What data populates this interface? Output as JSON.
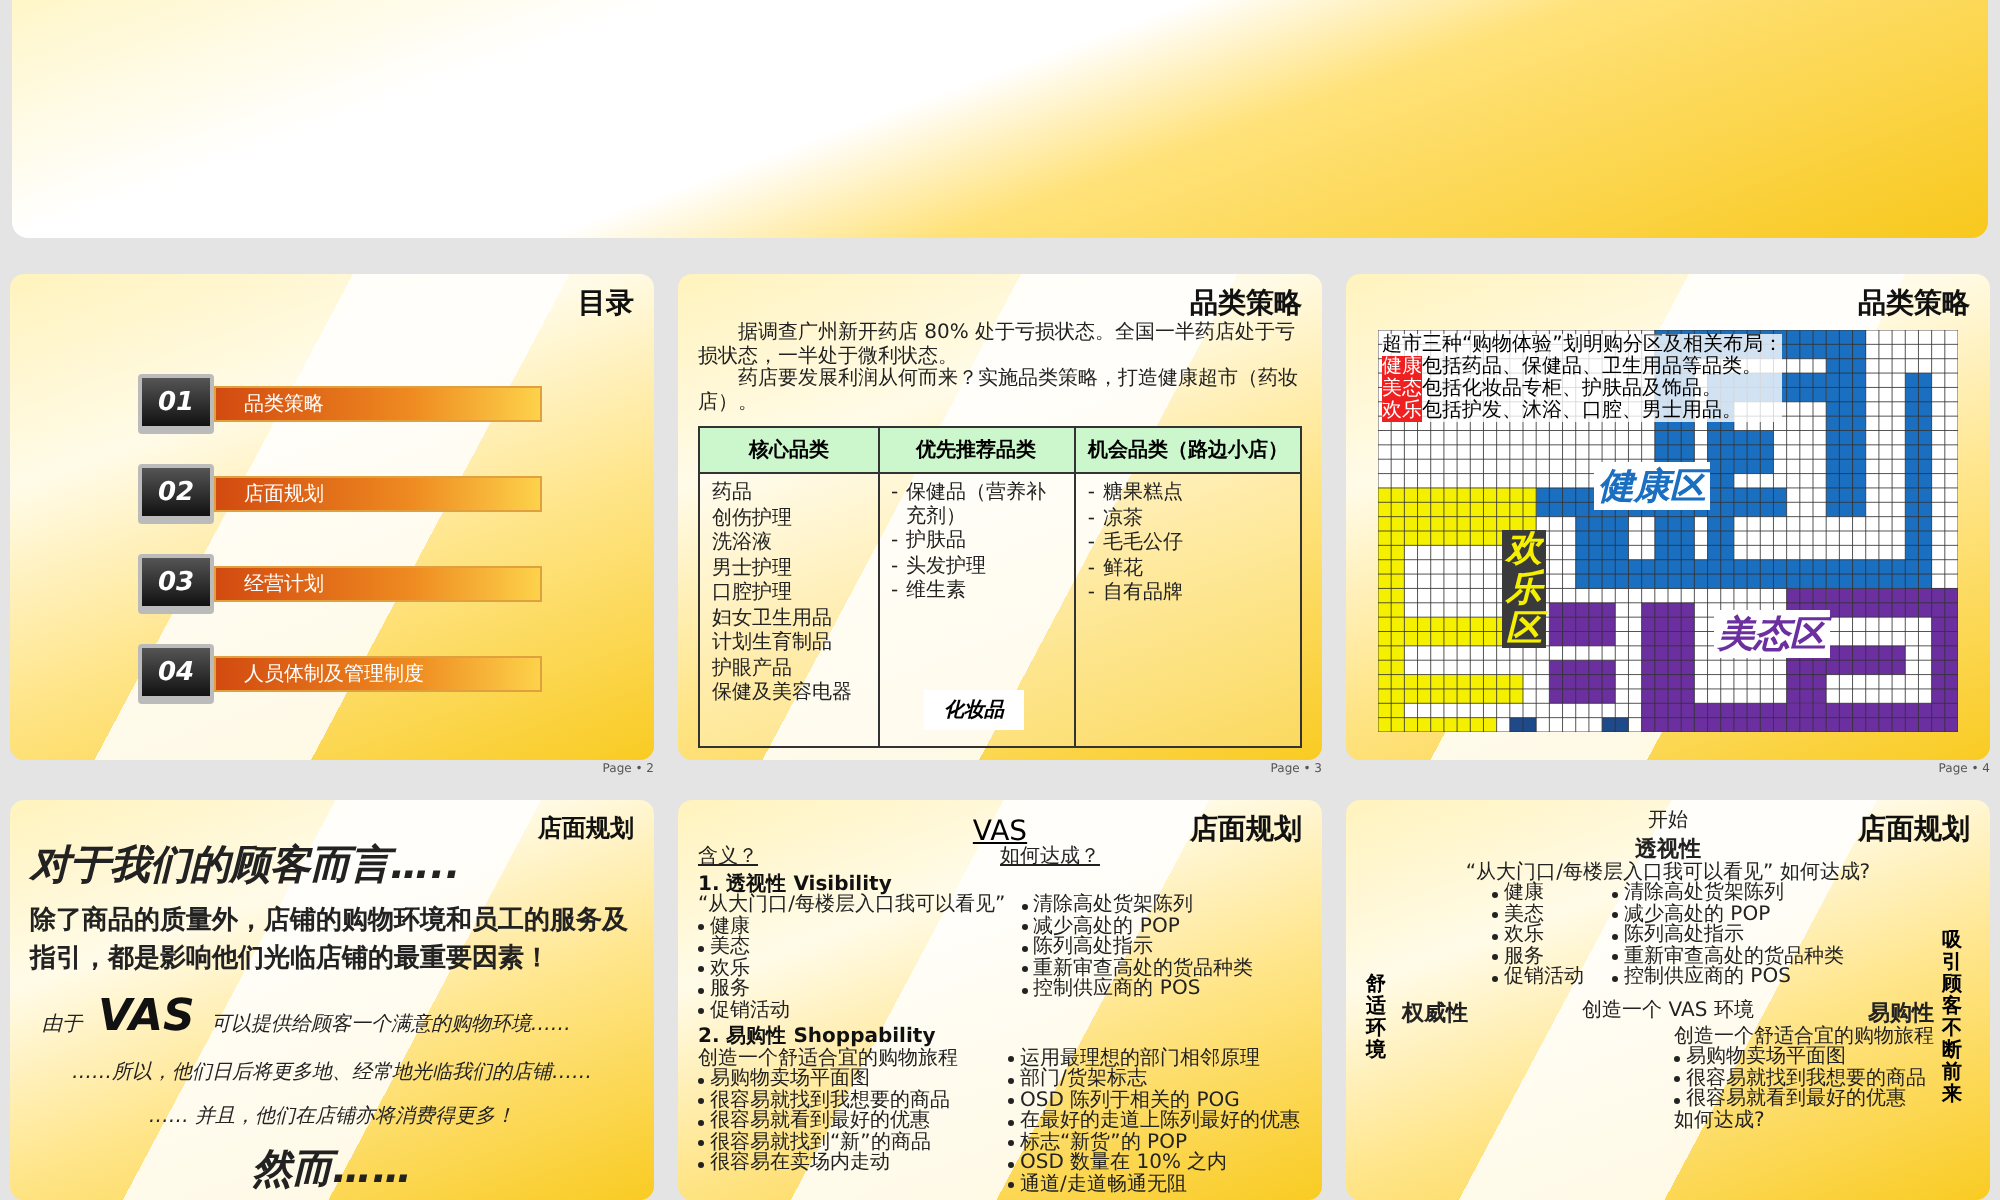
{
  "slides": [
    {
      "kind": "contents",
      "title": "目录",
      "page": "Page • 2",
      "items": [
        {
          "number": "01",
          "label": "品类策略"
        },
        {
          "number": "02",
          "label": "店面规划"
        },
        {
          "number": "03",
          "label": "经营计划"
        },
        {
          "number": "04",
          "label": "人员体制及管理制度"
        }
      ]
    },
    {
      "kind": "table",
      "title": "品类策略",
      "page": "Page • 3",
      "paragraphs": [
        "据调查广州新开药店 80% 处于亏损状态。全国一半药店处于亏损状态，一半处于微利状态。",
        "药店要发展利润从何而来？实施品类策略，打造健康超市（药妆店）。"
      ],
      "columns": [
        {
          "header": "核心品类",
          "items": [
            "药品",
            "创伤护理",
            "洗浴液",
            "男士护理",
            "口腔护理",
            "妇女卫生用品",
            "计划生育制品",
            "护眼产品",
            "保健及美容电器"
          ]
        },
        {
          "header": "优先推荐品类",
          "marker": "-",
          "items": [
            "保健品（营养补充剂）",
            "护肤品",
            "头发护理",
            "维生素"
          ]
        },
        {
          "header": "机会品类（路边小店）",
          "marker": "-",
          "items": [
            "糖果糕点",
            "凉茶",
            "毛毛公仔",
            "鲜花",
            "自有品牌"
          ]
        }
      ],
      "tag": "化妆品"
    },
    {
      "kind": "zones",
      "title": "品类策略",
      "page": "Page • 4",
      "intro": "超市三种“购物体验”划明购分区及相关布局：",
      "lines": [
        {
          "tag": "健康",
          "text": "包括药品、保健品、卫生用品等品类。"
        },
        {
          "tag": "美态",
          "text": "包括化妆品专柜、护肤品及饰品。"
        },
        {
          "tag": "欢乐",
          "text": "包括护发、沐浴、口腔、男士用品。"
        }
      ],
      "zones": [
        {
          "label": "健康区",
          "color": "#1a6fc0"
        },
        {
          "label": "欢乐区",
          "color": "#f5ef00"
        },
        {
          "label": "美态区",
          "color": "#6b2fa0"
        }
      ]
    },
    {
      "kind": "text",
      "title": "店面规划",
      "heading": "对于我们的顾客而言…..",
      "body": "除了商品的质量外，店铺的购物环境和员工的服务及指引，都是影响他们光临店铺的最重要因素！",
      "lead": "由于",
      "brand": "VAS",
      "lines": [
        "可以提供给顾客一个满意的购物环境……",
        "……所以，他们日后将更多地、经常地光临我们的店铺……",
        "…… 并且，他们在店铺亦将消费得更多！"
      ],
      "closing": "然而……"
    },
    {
      "kind": "vas",
      "title": "店面规划",
      "heading": "VAS",
      "headers": [
        "含义？",
        "如何达成？"
      ],
      "sections": [
        {
          "number": "1.",
          "name": "透视性",
          "english": "Visibility",
          "meaning": [
            "“从大门口/每楼层入口我可以看见”",
            "健康",
            "美态",
            "欢乐",
            "服务",
            "促销活动"
          ],
          "how": [
            "清除高处货架陈列",
            "减少高处的 POP",
            "陈列高处指示",
            "重新审查高处的货品种类",
            "控制供应商的 POS"
          ]
        },
        {
          "number": "2.",
          "name": "易购性",
          "english": "Shoppability",
          "meaning": [
            "创造一个舒适合宜的购物旅程",
            "易购物卖场平面图",
            "很容易就找到我想要的商品",
            "很容易就看到最好的优惠",
            "很容易就找到“新”的商品",
            "很容易在卖场内走动"
          ],
          "how": [
            "运用最理想的部门相邻原理",
            "部门/货架标志",
            "OSD 陈列于相关的 POG",
            "在最好的走道上陈列最好的优惠",
            "标志“新货”的 POP",
            "OSD 数量在 10% 之内",
            "通道/走道畅通无阻"
          ]
        }
      ]
    },
    {
      "kind": "map",
      "title": "店面规划",
      "start": "开始",
      "top": {
        "name": "透视性",
        "question": "“从大门口/每楼层入口我可以看见” 如何达成?",
        "left": [
          "健康",
          "美态",
          "欢乐",
          "服务",
          "促销活动"
        ],
        "right": [
          "清除高处货架陈列",
          "减少高处的 POP",
          "陈列高处指示",
          "重新审查高处的货品种类",
          "控制供应商的 POS"
        ]
      },
      "left_name": "权威性",
      "center": "创造一个 VAS 环境",
      "right_name": "易购性",
      "right_intro": "创造一个舒适合宜的购物旅程",
      "how": "如何达成?",
      "right_items": [
        "易购物卖场平面图",
        "很容易就找到我想要的商品",
        "很容易就看到最好的优惠"
      ],
      "side_left": "舒适环境",
      "side_right": "吸引顾客不断前来"
    }
  ]
}
